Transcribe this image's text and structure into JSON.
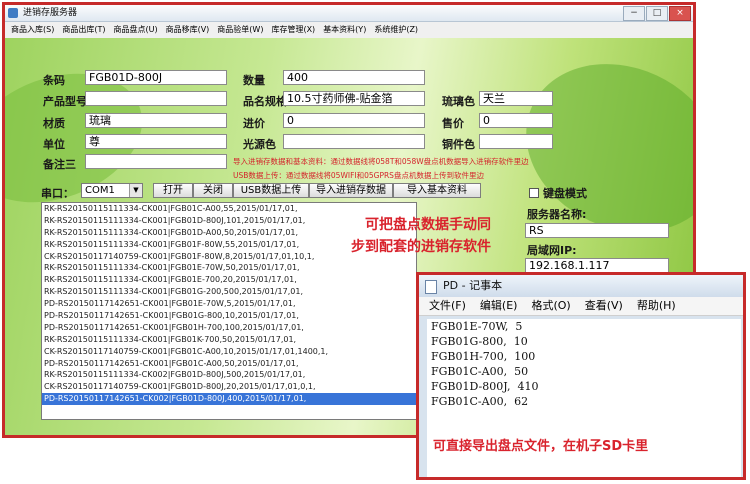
{
  "window": {
    "title": "进销存服务器",
    "controls": [
      "−",
      "□",
      "×"
    ]
  },
  "menu": [
    "商品入库(S)",
    "商品出库(T)",
    "商品盘点(U)",
    "商品移库(V)",
    "商品验单(W)",
    "库存管理(X)",
    "基本资料(Y)",
    "系统维护(Z)"
  ],
  "form": {
    "barcode_label": "条码",
    "barcode_value": "FGB01D-800J",
    "quantity_label": "数量",
    "quantity_value": "400",
    "model_label": "产品型号",
    "model_value": "",
    "spec_label": "品名规格",
    "spec_value": "10.5寸药师佛-贴金箔",
    "glaze_label": "琉璃色",
    "glaze_value": "天兰",
    "material_label": "材质",
    "material_value": "琉璃",
    "cost_label": "进价",
    "cost_value": "0",
    "price_label": "售价",
    "price_value": "0",
    "unit_label": "单位",
    "unit_value": "尊",
    "light_label": "光源色",
    "light_value": "",
    "copper_label": "铜件色",
    "copper_value": "",
    "note3_label": "备注三",
    "note3_value": ""
  },
  "hints": {
    "line1": "导入进销存数据和基本资料：通过数据线将058T和058W盘点机数据导入进销存软件里边",
    "line2": "USB数据上传：通过数据线将05WIFI和05GPRS盘点机数据上传到软件里边"
  },
  "toolbar": {
    "port_label": "串口：",
    "port_value": "COM1",
    "open": "打开",
    "close": "关闭",
    "usb_upload": "USB数据上传",
    "import_data": "导入进销存数据",
    "import_basic": "导入基本资料"
  },
  "right_panel": {
    "keyboard_mode": "键盘模式",
    "server_name_label": "服务器名称:",
    "server_name_value": "RS",
    "lan_ip_label": "局域网IP:",
    "lan_ip_value": "192.168.1.117"
  },
  "records": [
    "RK-RS20150115111334-CK001|FGB01C-A00,55,2015/01/17,01,",
    "RK-RS20150115111334-CK001|FGB01D-800J,101,2015/01/17,01,",
    "RK-RS20150115111334-CK001|FGB01D-A00,50,2015/01/17,01,",
    "RK-RS20150115111334-CK001|FGB01F-80W,55,2015/01/17,01,",
    "CK-RS20150117140759-CK001|FGB01F-80W,8,2015/01/17,01,10,1,",
    "RK-RS20150115111334-CK001|FGB01E-70W,50,2015/01/17,01,",
    "RK-RS20150115111334-CK001|FGB01E-700,20,2015/01/17,01,",
    "RK-RS20150115111334-CK001|FGB01G-200,500,2015/01/17,01,",
    "PD-RS20150117142651-CK001|FGB01E-70W,5,2015/01/17,01,",
    "PD-RS20150117142651-CK001|FGB01G-800,10,2015/01/17,01,",
    "PD-RS20150117142651-CK001|FGB01H-700,100,2015/01/17,01,",
    "RK-RS20150115111334-CK001|FGB01K-700,50,2015/01/17,01,",
    "CK-RS20150117140759-CK001|FGB01C-A00,10,2015/01/17,01,1400,1,",
    "PD-RS20150117142651-CK001|FGB01C-A00,50,2015/01/17,01,",
    "RK-RS20150115111334-CK002|FGB01D-800J,500,2015/01/17,01,",
    "CK-RS20150117140759-CK001|FGB01D-800J,20,2015/01/17,01,0,1,",
    "PD-RS20150117142651-CK002|FGB01D-800J,400,2015/01/17,01,"
  ],
  "annotation_main": [
    "可把盘点数据手动同",
    "步到配套的进销存软件"
  ],
  "notepad": {
    "title": "PD - 记事本",
    "menu": [
      "文件(F)",
      "编辑(E)",
      "格式(O)",
      "查看(V)",
      "帮助(H)"
    ],
    "lines": [
      "FGB01E-70W,  5",
      "FGB01G-800,  10",
      "FGB01H-700,  100",
      "FGB01C-A00,  50",
      "FGB01D-800J,  410",
      "FGB01C-A00,  62"
    ],
    "annotation": "可直接导出盘点文件，在机子SD卡里"
  }
}
